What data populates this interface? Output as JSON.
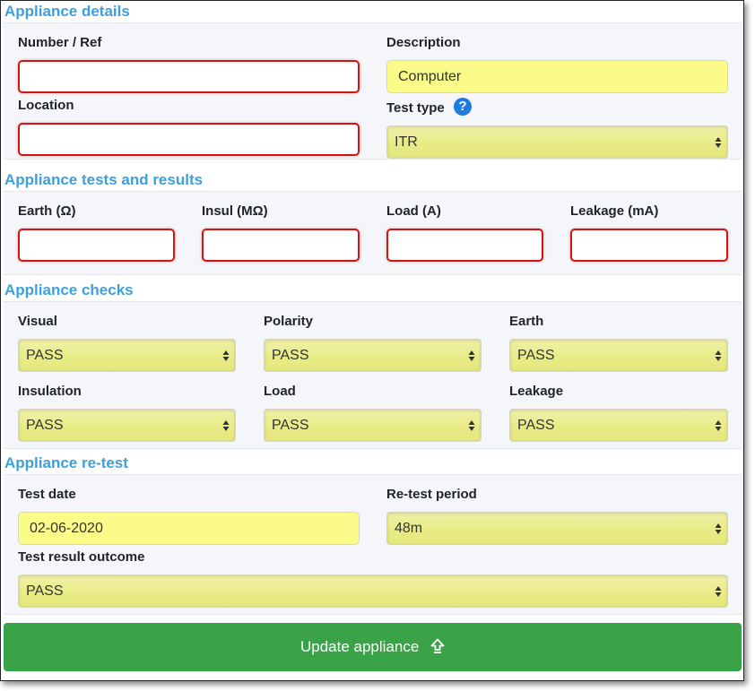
{
  "sections": {
    "details": "Appliance details",
    "tests": "Appliance tests and results",
    "checks": "Appliance checks",
    "retest": "Appliance re-test"
  },
  "details": {
    "number_label": "Number / Ref",
    "number_value": "",
    "description_label": "Description",
    "description_value": "Computer",
    "location_label": "Location",
    "location_value": "",
    "test_type_label": "Test type",
    "help_icon": "?",
    "test_type_value": "ITR"
  },
  "tests": {
    "earth_label": "Earth (Ω)",
    "insul_label": "Insul (MΩ)",
    "load_label": "Load (A)",
    "leakage_label": "Leakage (mA)"
  },
  "checks": {
    "visual_label": "Visual",
    "visual_value": "PASS",
    "polarity_label": "Polarity",
    "polarity_value": "PASS",
    "earth_label": "Earth",
    "earth_value": "PASS",
    "insulation_label": "Insulation",
    "insulation_value": "PASS",
    "load_label": "Load",
    "load_value": "PASS",
    "leakage_label": "Leakage",
    "leakage_value": "PASS"
  },
  "retest": {
    "date_label": "Test date",
    "date_value": "02-06-2020",
    "period_label": "Re-test period",
    "period_value": "48m",
    "outcome_label": "Test result outcome",
    "outcome_value": "PASS"
  },
  "button": {
    "label": "Update appliance",
    "icon": "upload-arrow-icon"
  },
  "colors": {
    "section_title": "#3ea0da",
    "error_border": "#d01515",
    "highlight": "#fbfb8a",
    "button": "#3aa348"
  }
}
